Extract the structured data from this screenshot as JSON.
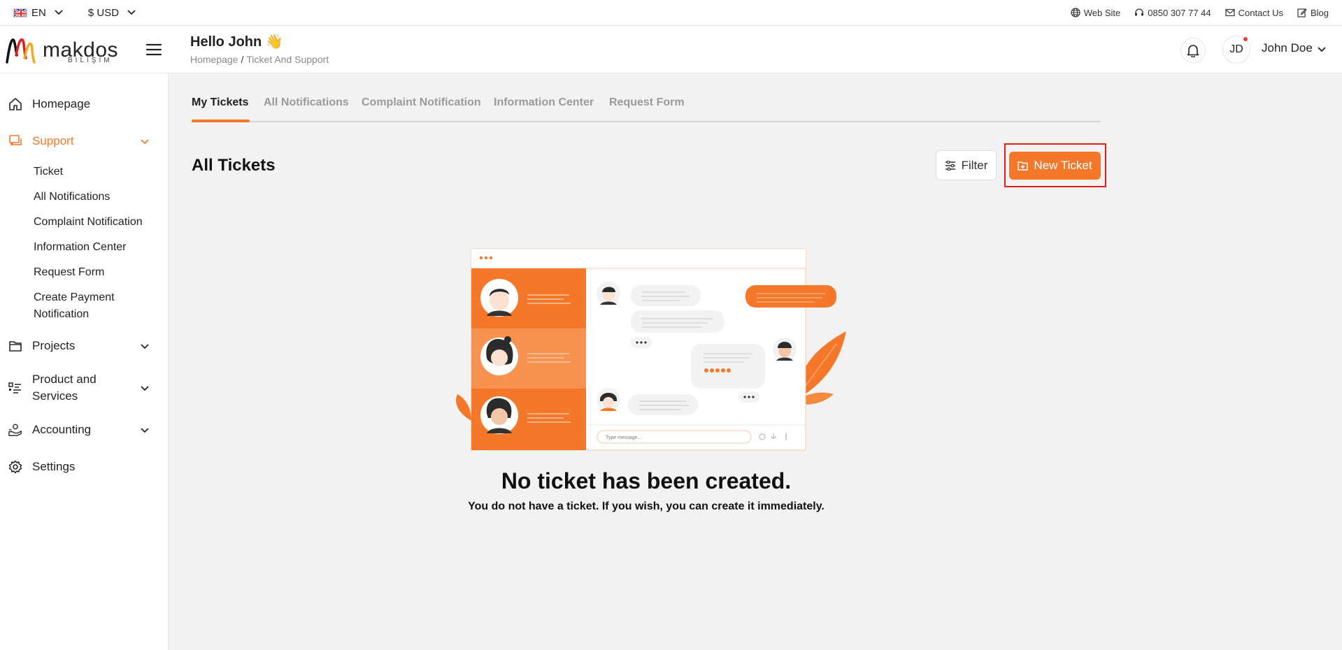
{
  "topbar": {
    "language": "EN",
    "currency": "$ USD",
    "links": [
      {
        "label": "Web Site",
        "icon": "globe-icon"
      },
      {
        "label": "0850 307 77 44",
        "icon": "headset-icon"
      },
      {
        "label": "Contact Us",
        "icon": "mail-icon"
      },
      {
        "label": "Blog",
        "icon": "edit-icon"
      }
    ]
  },
  "brand": {
    "name": "makdos",
    "sub": "BILIŞIM"
  },
  "header": {
    "greeting": "Hello John 👋",
    "breadcrumb": [
      "Homepage",
      "Ticket And Support"
    ],
    "avatar_initials": "JD",
    "user_name": "John Doe"
  },
  "sidebar": {
    "items": [
      {
        "label": "Homepage"
      },
      {
        "label": "Support"
      },
      {
        "label": "Projects"
      },
      {
        "label": "Product and Services"
      },
      {
        "label": "Accounting"
      },
      {
        "label": "Settings"
      }
    ],
    "support_sub": [
      "Ticket",
      "All Notifications",
      "Complaint Notification",
      "Information Center",
      "Request Form",
      "Create Payment Notification"
    ]
  },
  "tabs": [
    "My Tickets",
    "All Notifications",
    "Complaint Notification",
    "Information Center",
    "Request Form"
  ],
  "main": {
    "section_title": "All Tickets",
    "filter_label": "Filter",
    "new_ticket_label": "New Ticket",
    "empty_title": "No ticket has been created.",
    "empty_desc": "You do not have a ticket. If you wish, you can create it immediately.",
    "illustration_placeholder": "Type message..."
  },
  "colors": {
    "accent": "#f5782a",
    "highlight_outline": "#e81b1b",
    "notification_dot": "#f0393c"
  }
}
